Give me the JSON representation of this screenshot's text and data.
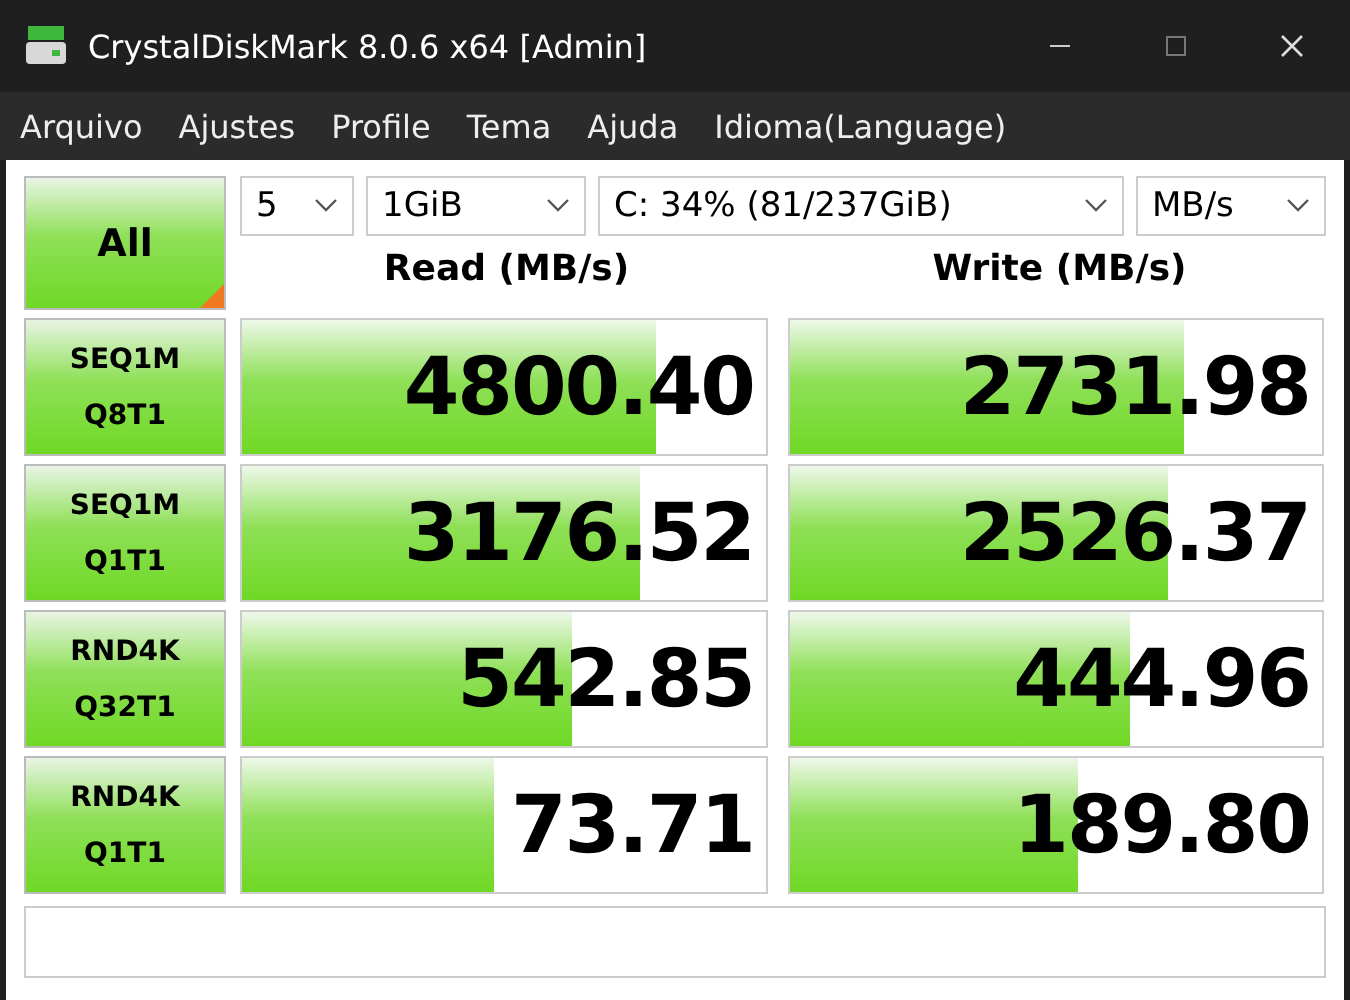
{
  "window": {
    "title": "CrystalDiskMark 8.0.6 x64 [Admin]"
  },
  "menu": [
    "Arquivo",
    "Ajustes",
    "Profile",
    "Tema",
    "Ajuda",
    "Idioma(Language)"
  ],
  "all_button": {
    "label": "All"
  },
  "selectors": [
    {
      "value": "5"
    },
    {
      "value": "1GiB"
    },
    {
      "value": "C: 34% (81/237GiB)"
    },
    {
      "value": "MB/s"
    }
  ],
  "headers": {
    "read": "Read (MB/s)",
    "write": "Write (MB/s)"
  },
  "rows": [
    {
      "test": "SEQ1M",
      "params": "Q8T1",
      "read": {
        "value": "4800.40",
        "level": 0.79
      },
      "write": {
        "value": "2731.98",
        "level": 0.74
      }
    },
    {
      "test": "SEQ1M",
      "params": "Q1T1",
      "read": {
        "value": "3176.52",
        "level": 0.76
      },
      "write": {
        "value": "2526.37",
        "level": 0.71
      }
    },
    {
      "test": "RND4K",
      "params": "Q32T1",
      "read": {
        "value": "542.85",
        "level": 0.63
      },
      "write": {
        "value": "444.96",
        "level": 0.64
      }
    },
    {
      "test": "RND4K",
      "params": "Q1T1",
      "read": {
        "value": "73.71",
        "level": 0.48
      },
      "write": {
        "value": "189.80",
        "level": 0.54
      }
    }
  ]
}
